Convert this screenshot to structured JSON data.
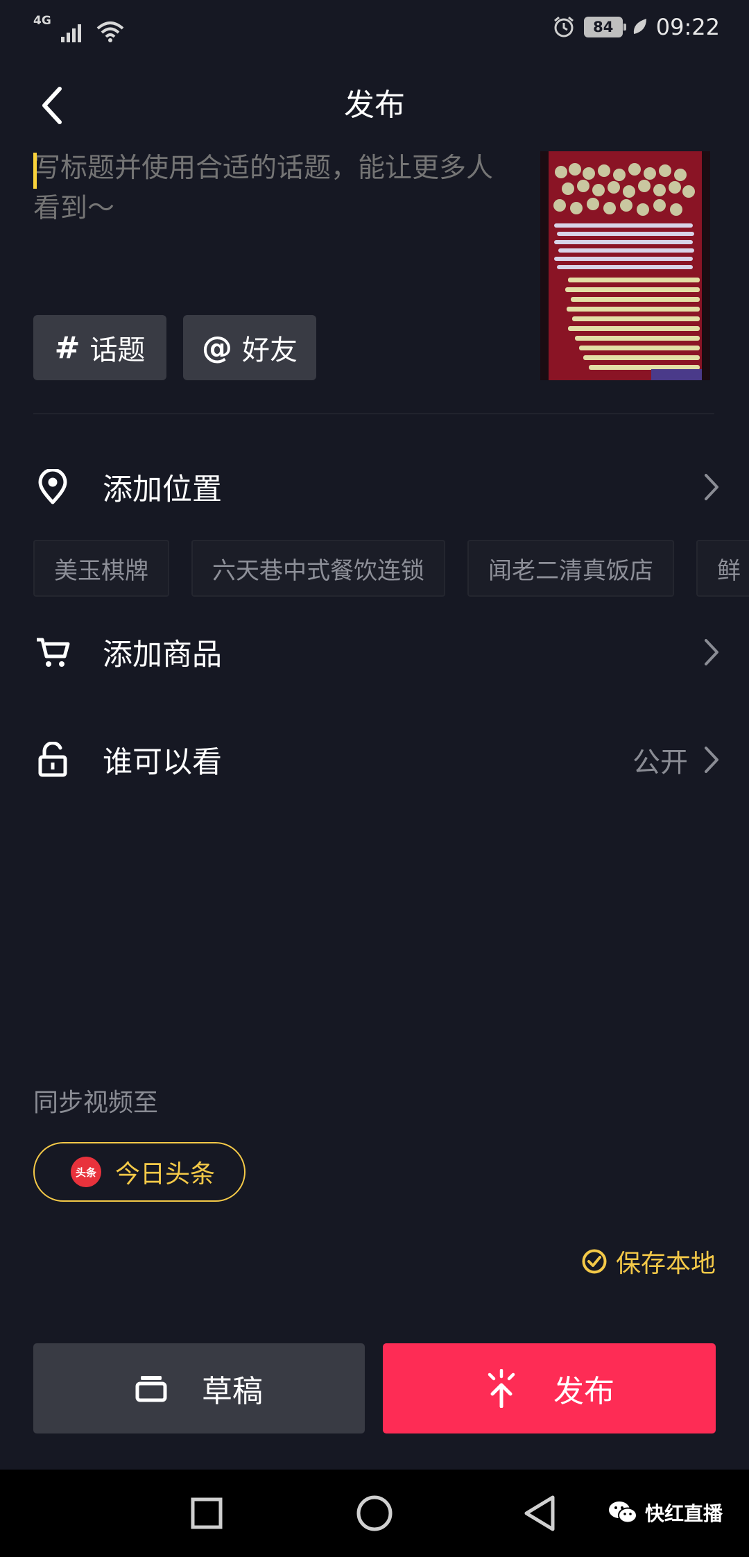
{
  "status_bar": {
    "network": "4G",
    "battery": "84",
    "time": "09:22"
  },
  "header": {
    "title": "发布"
  },
  "caption": {
    "placeholder": "写标题并使用合适的话题，能让更多人看到～"
  },
  "chips": {
    "topic_symbol": "#",
    "topic_label": "话题",
    "friend_symbol": "@",
    "friend_label": "好友"
  },
  "location": {
    "label": "添加位置",
    "suggestions": [
      "美玉棋牌",
      "六天巷中式餐饮连锁",
      "闻老二清真饭店",
      "鲜"
    ]
  },
  "product": {
    "label": "添加商品"
  },
  "privacy": {
    "label": "谁可以看",
    "value": "公开"
  },
  "sync": {
    "label": "同步视频至",
    "target_logo": "头条",
    "target": "今日头条"
  },
  "save_local": {
    "label": "保存本地"
  },
  "buttons": {
    "draft": "草稿",
    "publish": "发布"
  },
  "watermark": {
    "text": "快红直播"
  },
  "colors": {
    "background": "#161823",
    "accent_yellow": "#f4c948",
    "publish_red": "#fe2c55"
  }
}
